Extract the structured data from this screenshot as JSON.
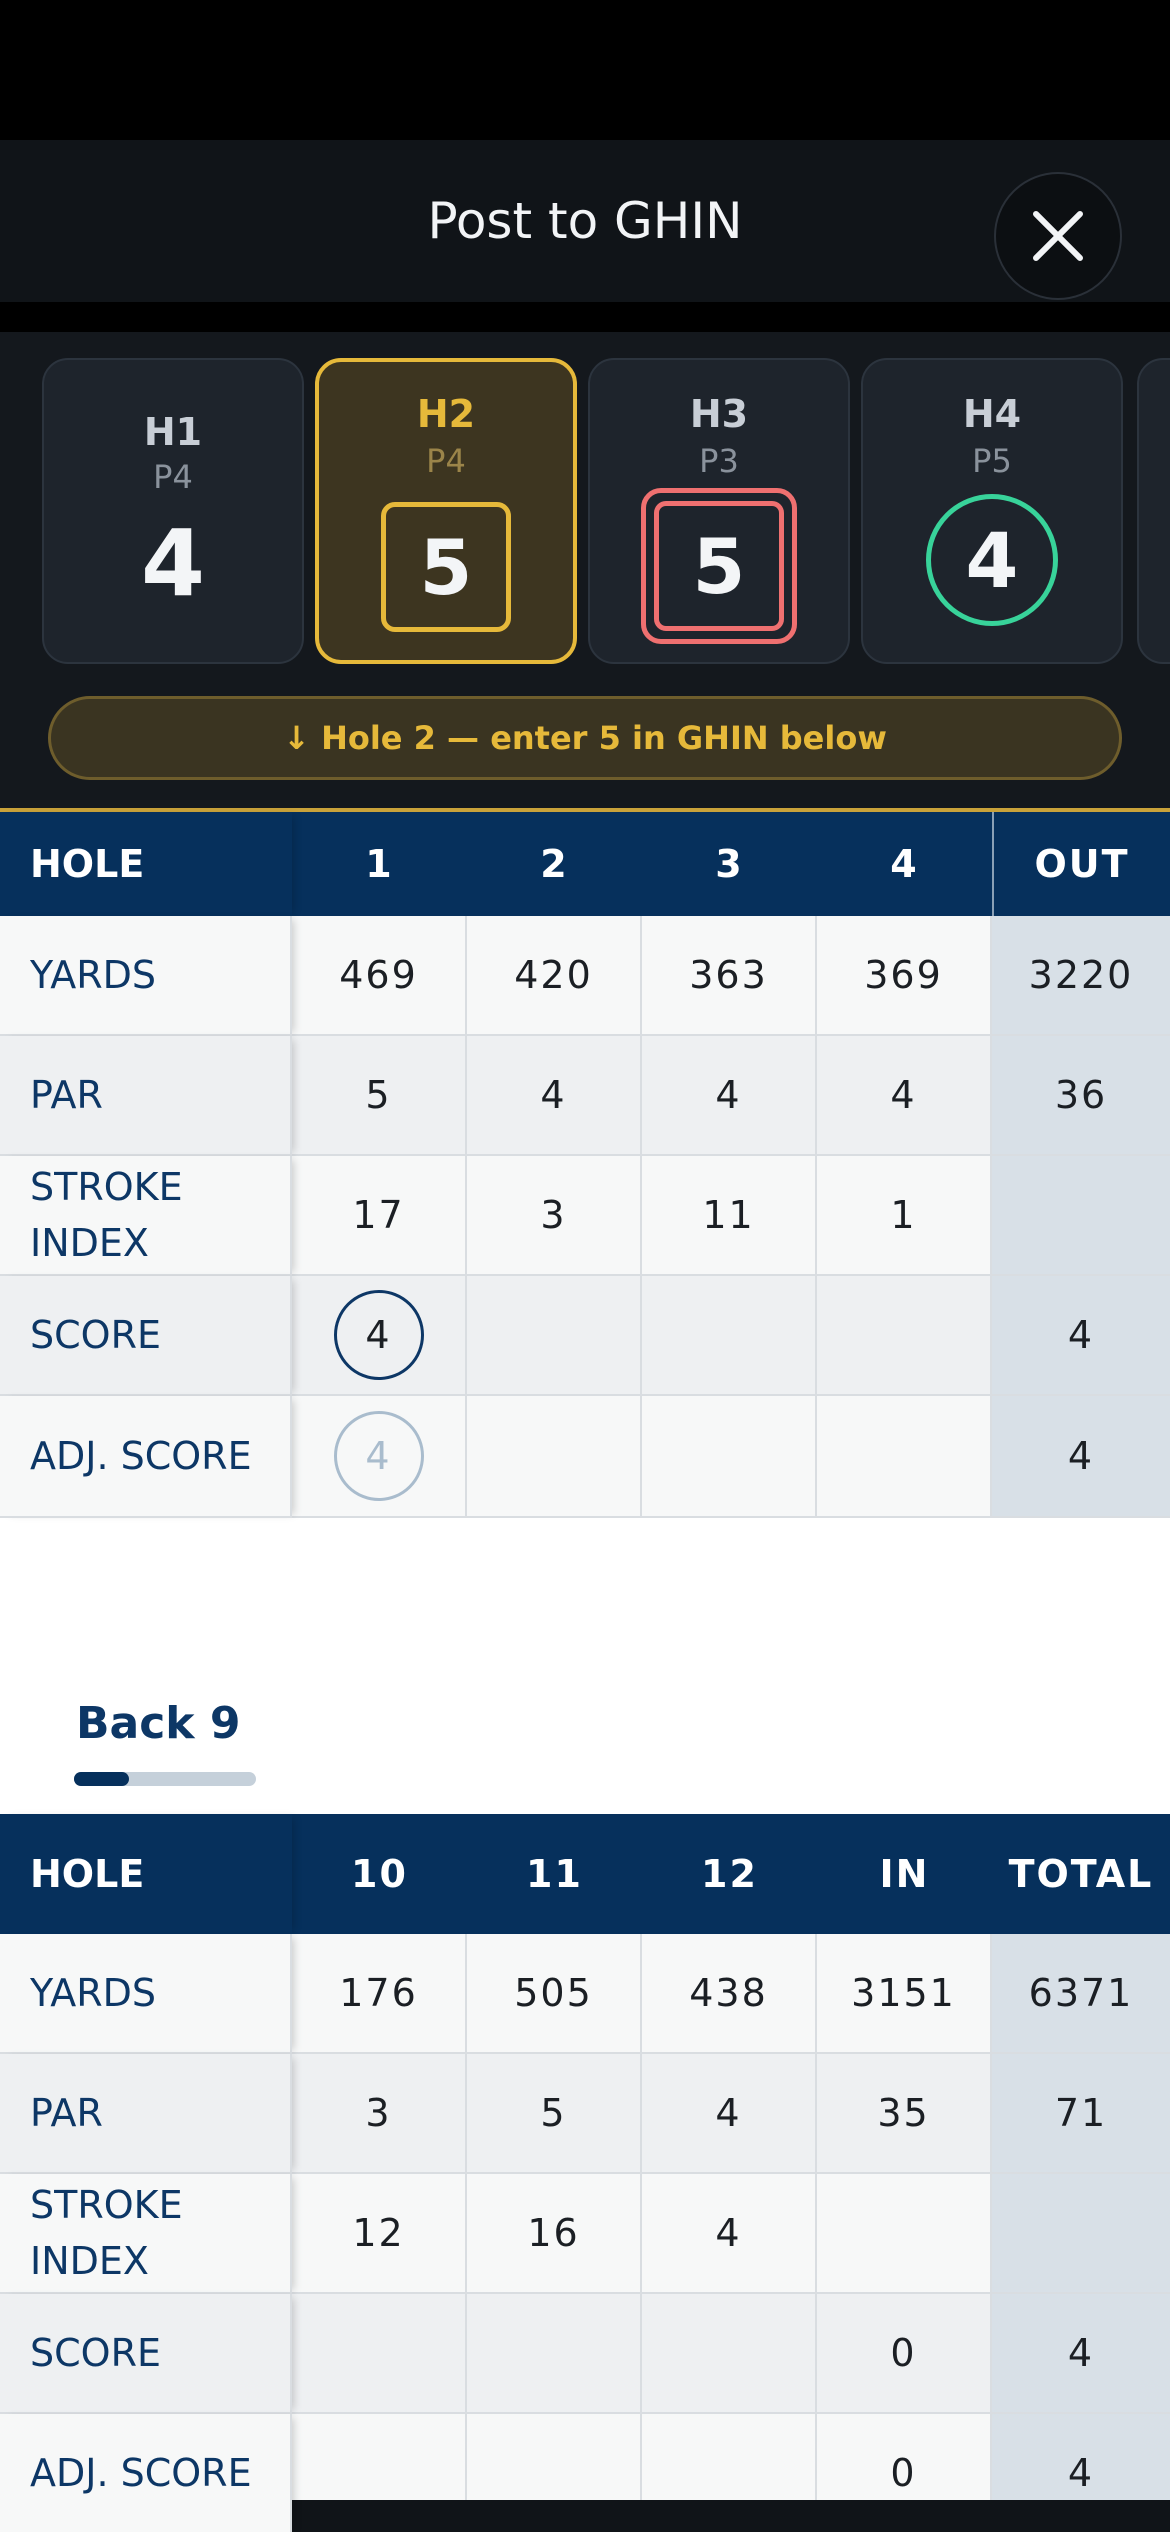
{
  "header": {
    "title": "Post to GHIN",
    "close_icon": "close-icon"
  },
  "hole_cards": [
    {
      "hole": "H1",
      "par": "P4",
      "score": "4",
      "style": "plain"
    },
    {
      "hole": "H2",
      "par": "P4",
      "score": "5",
      "style": "bogey-active"
    },
    {
      "hole": "H3",
      "par": "P3",
      "score": "5",
      "style": "double-bogey"
    },
    {
      "hole": "H4",
      "par": "P5",
      "score": "4",
      "style": "birdie"
    }
  ],
  "banner": {
    "text": "↓ Hole 2 — enter 5 in GHIN below"
  },
  "front9": {
    "header": [
      "HOLE",
      "1",
      "2",
      "3",
      "4",
      "OUT"
    ],
    "rows": [
      {
        "label": "YARDS",
        "values": [
          "469",
          "420",
          "363",
          "369",
          "3220"
        ]
      },
      {
        "label": "PAR",
        "values": [
          "5",
          "4",
          "4",
          "4",
          "36"
        ]
      },
      {
        "label": "STROKE INDEX",
        "values": [
          "17",
          "3",
          "11",
          "1",
          ""
        ]
      },
      {
        "label": "SCORE",
        "values": [
          "4",
          "",
          "",
          "",
          "4"
        ]
      },
      {
        "label": "ADJ. SCORE",
        "values": [
          "4",
          "",
          "",
          "",
          "4"
        ]
      }
    ]
  },
  "back9_tab": {
    "label": "Back 9",
    "progress": 0.3
  },
  "back9": {
    "header": [
      "HOLE",
      "10",
      "11",
      "12",
      "IN",
      "TOTAL"
    ],
    "rows": [
      {
        "label": "YARDS",
        "values": [
          "176",
          "505",
          "438",
          "3151",
          "6371"
        ]
      },
      {
        "label": "PAR",
        "values": [
          "3",
          "5",
          "4",
          "35",
          "71"
        ]
      },
      {
        "label": "STROKE INDEX",
        "values": [
          "12",
          "16",
          "4",
          "",
          ""
        ]
      },
      {
        "label": "SCORE",
        "values": [
          "",
          "",
          "",
          "0",
          "4"
        ]
      },
      {
        "label": "ADJ. SCORE",
        "values": [
          "",
          "",
          "",
          "0",
          "4"
        ]
      }
    ]
  },
  "colors": {
    "accent_gold": "#e6b93a",
    "double_bogey_red": "#ef7070",
    "birdie_green": "#38d39a",
    "navy": "#06305c"
  }
}
